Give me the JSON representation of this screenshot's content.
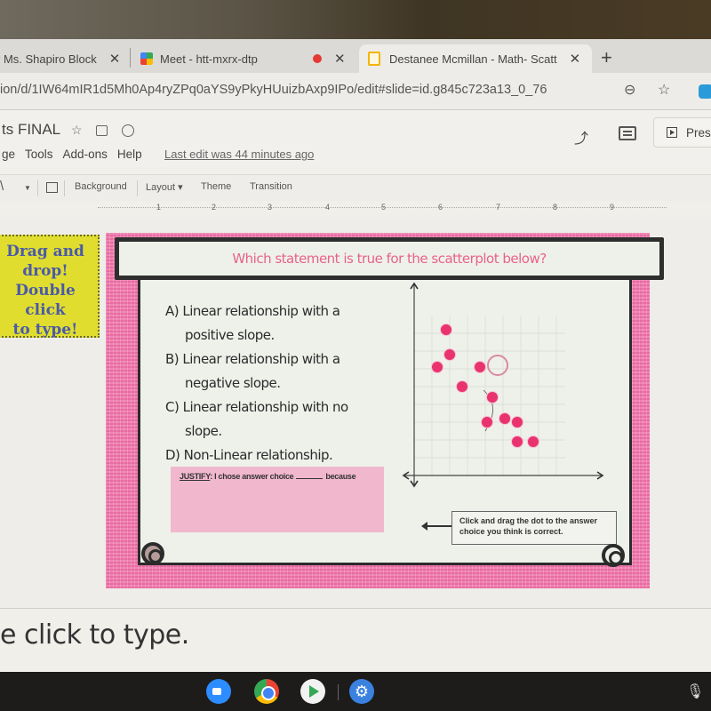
{
  "browser": {
    "tabs": [
      {
        "label": "r Ms. Shapiro Block",
        "close": "✕"
      },
      {
        "label": "Meet - htt-mxrx-dtp",
        "close": ""
      },
      {
        "label": "",
        "close": "✕",
        "recording": true
      },
      {
        "label": "Destanee Mcmillan - Math- Scatt",
        "close": "✕",
        "active": true
      }
    ],
    "new_tab": "+",
    "url": "ion/d/1IW64mIR1d5Mh0Ap4ryZPq0aYS9yPkyHUuizbAxp9IPo/edit#slide=id.g845c723a13_0_76",
    "icons": {
      "zoom": "⊖",
      "star": "☆"
    }
  },
  "doc": {
    "title": "ts FINAL",
    "title_icons": {
      "star": "☆"
    },
    "menu": [
      "ge",
      "Tools",
      "Add-ons",
      "Help"
    ],
    "last_edit": "Last edit was 44 minutes ago",
    "present_label": "Pres",
    "trend_icon": "⤴"
  },
  "toolbar": {
    "line_tool": "\\",
    "caret": "▼",
    "background": "Background",
    "layout": "Layout ▾",
    "theme": "Theme",
    "transition": "Transition"
  },
  "ruler": [
    "1",
    "2",
    "3",
    "4",
    "5",
    "6",
    "7",
    "8",
    "9"
  ],
  "sticky": {
    "lines": [
      "Drag and",
      "drop!",
      "Double click",
      "to type!"
    ]
  },
  "slide": {
    "question": "Which statement is true for the scatterplot below?",
    "options": [
      {
        "line1": "A) Linear relationship with a",
        "line2": "positive slope."
      },
      {
        "line1": "B) Linear relationship with a",
        "line2": "negative slope."
      },
      {
        "line1": "C) Linear relationship with no",
        "line2": "slope."
      },
      {
        "line1": "D) Non-Linear relationship.",
        "line2": ""
      }
    ],
    "justify": {
      "label": "JUSTIFY",
      "text_before": ": I chose answer choice",
      "text_after": "because"
    },
    "hint": "Click and drag the dot to the answer choice you think is correct.",
    "colors": {
      "dot": "#e8336f",
      "frame": "#ec7aaf",
      "question": "#e8628c",
      "sticky": "#e0dd2e"
    }
  },
  "chart_data": {
    "type": "scatter",
    "title": "",
    "xlabel": "",
    "ylabel": "",
    "xlim": [
      0,
      10
    ],
    "ylim": [
      0,
      10
    ],
    "grid": true,
    "points": [
      {
        "x": 1.8,
        "y": 8.2
      },
      {
        "x": 2.0,
        "y": 6.8
      },
      {
        "x": 1.3,
        "y": 6.1
      },
      {
        "x": 2.7,
        "y": 5.0
      },
      {
        "x": 3.7,
        "y": 6.1
      },
      {
        "x": 4.4,
        "y": 4.4
      },
      {
        "x": 4.1,
        "y": 3.0
      },
      {
        "x": 5.1,
        "y": 3.2
      },
      {
        "x": 5.8,
        "y": 3.0
      },
      {
        "x": 5.8,
        "y": 1.9
      },
      {
        "x": 6.7,
        "y": 1.9
      }
    ],
    "draggable_target": {
      "x": 4.7,
      "y": 6.2,
      "hollow": true
    }
  },
  "notes": {
    "text": "e click to type."
  },
  "shelf": {
    "apps": [
      "zoom",
      "chrome",
      "play-store",
      "settings"
    ],
    "settings_glyph": "⚙",
    "mic_glyph": "🎙"
  }
}
